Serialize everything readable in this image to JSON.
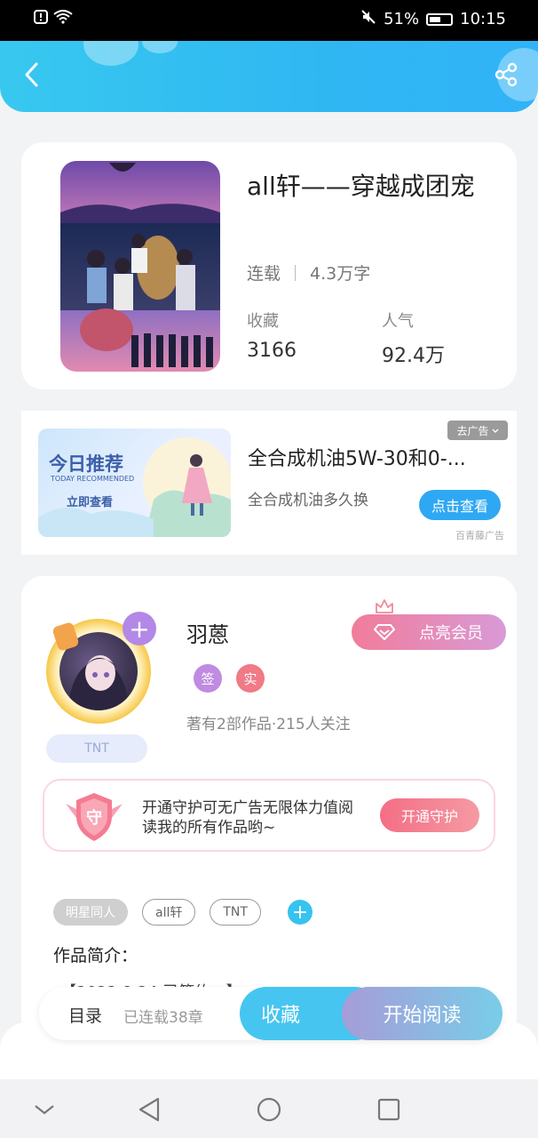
{
  "status_bar": {
    "battery": "51%",
    "time": "10:15"
  },
  "header": {
    "back_icon": "chevron-left-icon",
    "share_icon": "share-icon"
  },
  "book": {
    "title": "all轩——穿越成团宠",
    "status": "连载",
    "word_count": "4.3万字",
    "favorites_label": "收藏",
    "favorites_value": "3166",
    "popularity_label": "人气",
    "popularity_value": "92.4万"
  },
  "ad": {
    "image_headline": "今日推荐",
    "image_subline": "TODAY RECOMMENDED",
    "image_button": "立即查看",
    "title": "全合成机油5W-30和0-...",
    "description": "全合成机油多久换",
    "cta": "点击查看",
    "remove_label": "去广告",
    "source": "百青藤广告"
  },
  "author": {
    "name": "羽蒽",
    "badges": [
      {
        "label": "签",
        "color": "#c08be0"
      },
      {
        "label": "实",
        "color": "#f07a86"
      }
    ],
    "stats": "著有2部作品·215人关注",
    "fan_badge": "TNT",
    "vip_button": "点亮会员",
    "guard_icon_label": "守",
    "guard_text": "开通守护可无广告无限体力值阅读我的所有作品哟~",
    "guard_button": "开通守护"
  },
  "tags": [
    "明星同人",
    "all轩",
    "TNT"
  ],
  "intro": {
    "label": "作品简介：",
    "text": "【2022.8.24 已签约...】"
  },
  "bottom_bar": {
    "toc_label": "目录",
    "chapters": "已连载38章",
    "favorite_button": "收藏",
    "read_button": "开始阅读"
  },
  "colors": {
    "accent": "#2fb7f2",
    "pink": "#f46e86",
    "purple": "#b388e6"
  }
}
